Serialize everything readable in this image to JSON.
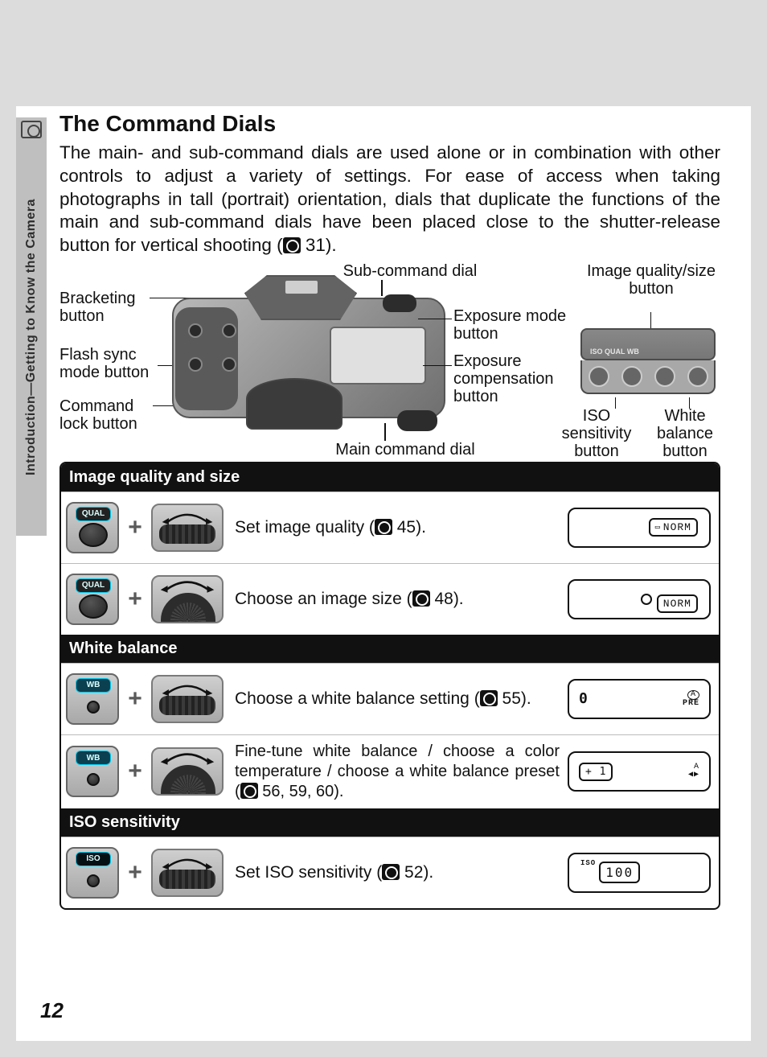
{
  "sidebar": {
    "text": "Introduction—Getting to Know the Camera"
  },
  "title": "The Command Dials",
  "lead_a": "The main- and sub-command dials are used alone or in combination with other controls to adjust a variety of settings.  For ease of access when taking photographs in tall (portrait) orientation, dials that duplicate the functions of the main and sub-command dials have been placed close to the shutter-release button for vertical shooting (",
  "lead_page": " 31).",
  "labels": {
    "bracketing": "Bracketing button",
    "flash_sync": "Flash sync mode button",
    "command_lock": "Command lock button",
    "sub_dial": "Sub-command dial",
    "exp_mode": "Exposure mode button",
    "exp_comp": "Exposure compensation button",
    "main_dial": "Main command dial",
    "img_qual": "Image quality/size button",
    "iso_btn": "ISO sensitivity button",
    "wb_btn": "White balance button"
  },
  "mini_panel_tags": "ISO   QUAL   WB",
  "sections": {
    "iq": "Image quality and size",
    "wb": "White balance",
    "iso": "ISO sensitivity"
  },
  "rows": {
    "iq1": {
      "btn": "QUAL",
      "desc_a": "Set image quality (",
      "desc_b": " 45).",
      "result": "NORM"
    },
    "iq2": {
      "btn": "QUAL",
      "desc_a": "Choose an image size (",
      "desc_b": " 48).",
      "result": "NORM"
    },
    "wb1": {
      "btn": "WB",
      "desc_a": "Choose a white balance setting (",
      "desc_b": " 55).",
      "left": "0",
      "right": "PRE"
    },
    "wb2": {
      "btn": "WB",
      "desc_a": "Fine-tune white balance / choose a color temperature / choose a white balance preset (",
      "desc_b": " 56, 59, 60).",
      "left": "+ 1",
      "right": "A"
    },
    "iso1": {
      "btn": "ISO",
      "desc_a": "Set ISO sensitivity (",
      "desc_b": " 52).",
      "left": "ISO",
      "val": "100"
    }
  },
  "page_number": "12",
  "plus": "+"
}
